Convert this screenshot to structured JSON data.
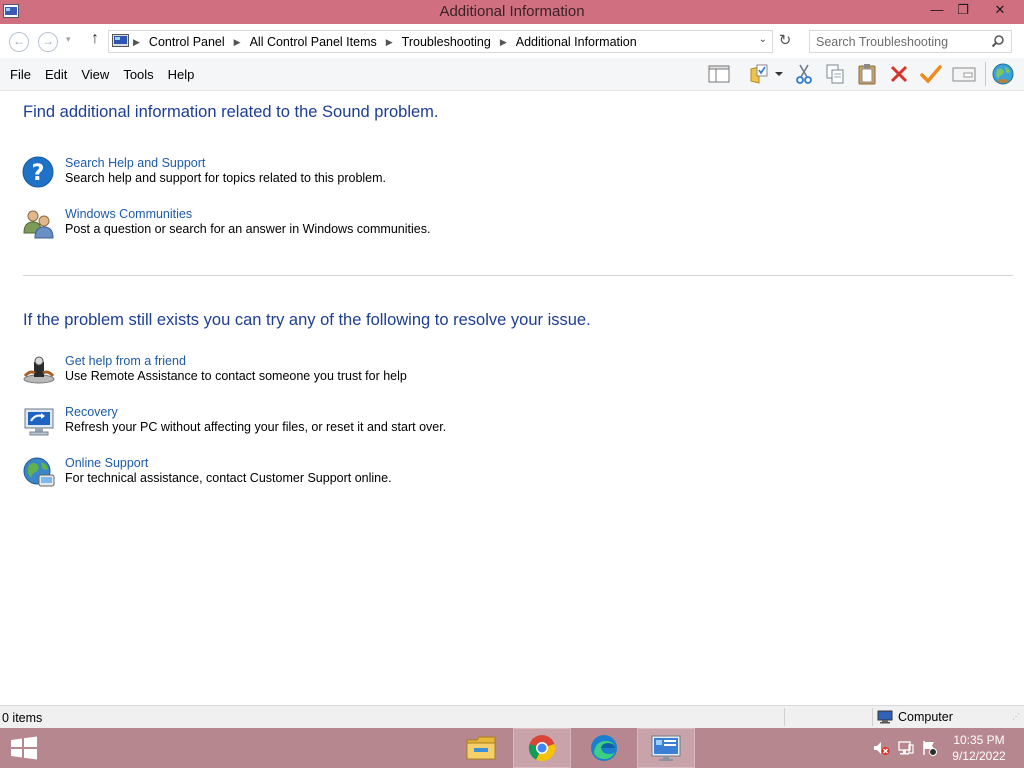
{
  "window": {
    "title": "Additional Information",
    "min_glyph": "—",
    "max_glyph": "❐",
    "close_glyph": "✕"
  },
  "nav": {
    "back_glyph": "←",
    "forward_glyph": "→",
    "recent_glyph": "▾",
    "up_glyph": "↑",
    "breadcrumbs": [
      "Control Panel",
      "All Control Panel Items",
      "Troubleshooting",
      "Additional Information"
    ],
    "separator": "▶",
    "dropdown_glyph": "⌄",
    "refresh_glyph": "↻"
  },
  "search": {
    "placeholder": "Search Troubleshooting"
  },
  "menu": {
    "file": "File",
    "edit": "Edit",
    "view": "View",
    "tools": "Tools",
    "help": "Help"
  },
  "toolbar": {
    "icons": [
      "preview-pane-icon",
      "folder-options-icon",
      "cut-icon",
      "copy-icon",
      "paste-icon",
      "delete-icon",
      "checkmark-icon",
      "properties-icon",
      "globe-icon"
    ]
  },
  "main": {
    "heading1": "Find additional information related to the Sound problem.",
    "items1": [
      {
        "icon": "help-icon",
        "link": "Search Help and Support",
        "desc": "Search help and support for topics related to this problem."
      },
      {
        "icon": "communities-icon",
        "link": "Windows Communities",
        "desc": "Post a question or search for an answer in Windows communities."
      }
    ],
    "heading2": "If the problem still exists you can try any of the following to resolve your issue.",
    "items2": [
      {
        "icon": "remote-assistance-icon",
        "link": "Get help from a friend",
        "desc": "Use Remote Assistance to contact someone you trust for help"
      },
      {
        "icon": "recovery-icon",
        "link": "Recovery",
        "desc": "Refresh your PC without affecting your files, or reset it and start over."
      },
      {
        "icon": "online-support-icon",
        "link": "Online Support",
        "desc": "For technical assistance, contact Customer Support online."
      }
    ]
  },
  "status": {
    "count": "0 items",
    "location": "Computer",
    "grip_glyph": "⋰"
  },
  "taskbar": {
    "apps": [
      "file-explorer",
      "chrome",
      "edge",
      "control-panel"
    ],
    "active_app": "control-panel",
    "time": "10:35 PM",
    "date": "9/12/2022"
  },
  "colors": {
    "titlebar": "#cf6f80",
    "taskbar": "#b7878f",
    "heading": "#1c3e93",
    "link": "#1e5ba8"
  }
}
